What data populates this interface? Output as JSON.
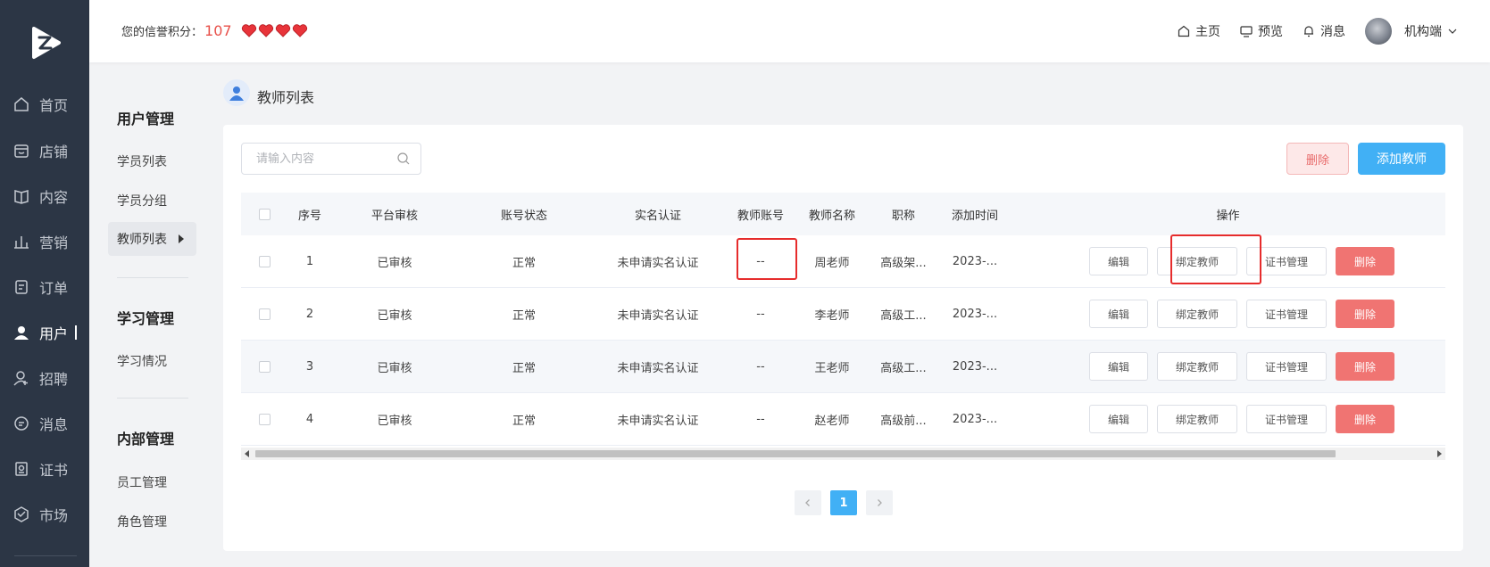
{
  "nav": {
    "items": [
      {
        "label": "首页",
        "icon": "home-icon"
      },
      {
        "label": "店铺",
        "icon": "store-icon"
      },
      {
        "label": "内容",
        "icon": "book-icon"
      },
      {
        "label": "营销",
        "icon": "chart-icon"
      },
      {
        "label": "订单",
        "icon": "order-icon"
      },
      {
        "label": "用户",
        "icon": "user-icon",
        "active": true
      },
      {
        "label": "招聘",
        "icon": "recruit-icon"
      },
      {
        "label": "消息",
        "icon": "message-icon"
      },
      {
        "label": "证书",
        "icon": "certificate-icon"
      },
      {
        "label": "市场",
        "icon": "market-icon"
      }
    ]
  },
  "header": {
    "credit_label": "您的信誉积分：",
    "credit_score": "107",
    "hearts": 4,
    "home": "主页",
    "preview": "预览",
    "messages": "消息",
    "account": "机构端"
  },
  "subnav": {
    "group1": "用户管理",
    "student_list": "学员列表",
    "student_group": "学员分组",
    "teacher_list": "教师列表",
    "group2": "学习管理",
    "study_status": "学习情况",
    "group3": "内部管理",
    "staff": "员工管理",
    "roles": "角色管理"
  },
  "page": {
    "title": "教师列表"
  },
  "toolbar": {
    "search_placeholder": "请输入内容",
    "delete_label": "删除",
    "add_label": "添加教师"
  },
  "table": {
    "headers": {
      "index": "序号",
      "audit": "平台审核",
      "status": "账号状态",
      "realname": "实名认证",
      "account": "教师账号",
      "name": "教师名称",
      "title": "职称",
      "added": "添加时间",
      "ops": "操作"
    },
    "rows": [
      {
        "index": "1",
        "audit": "已审核",
        "status": "正常",
        "realname": "未申请实名认证",
        "account": "--",
        "name": "周老师",
        "title": "高级架...",
        "added": "2023-..."
      },
      {
        "index": "2",
        "audit": "已审核",
        "status": "正常",
        "realname": "未申请实名认证",
        "account": "--",
        "name": "李老师",
        "title": "高级工...",
        "added": "2023-..."
      },
      {
        "index": "3",
        "audit": "已审核",
        "status": "正常",
        "realname": "未申请实名认证",
        "account": "--",
        "name": "王老师",
        "title": "高级工...",
        "added": "2023-..."
      },
      {
        "index": "4",
        "audit": "已审核",
        "status": "正常",
        "realname": "未申请实名认证",
        "account": "--",
        "name": "赵老师",
        "title": "高级前...",
        "added": "2023-..."
      }
    ],
    "ops": {
      "edit": "编辑",
      "bind": "绑定教师",
      "cert": "证书管理",
      "delete": "删除"
    }
  },
  "pagination": {
    "current": "1"
  },
  "colors": {
    "accent": "#41b0f5",
    "danger": "#f07472",
    "highlight": "#e62c2c",
    "nav_bg": "#2c3645"
  }
}
